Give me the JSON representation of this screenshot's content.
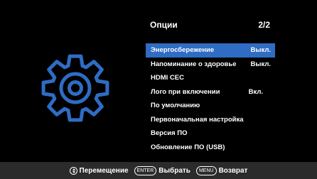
{
  "colors": {
    "background": "#000000",
    "highlight": "#2f6cc4",
    "gear": "#2f6cc4",
    "footer": "#2b2b2b",
    "text": "#ffffff"
  },
  "icon": "gear-icon",
  "menu": {
    "title": "Опции",
    "page": "2/2",
    "items": [
      {
        "label": "Энергосбережение",
        "value": "Выкл.",
        "selected": true
      },
      {
        "label": "Напоминание о здоровье",
        "value": "Выкл.",
        "selected": false
      },
      {
        "label": "HDMI CEC",
        "value": "",
        "selected": false
      },
      {
        "label": "Лого при включении",
        "value": "Вкл.",
        "selected": false
      },
      {
        "label": "По умолчанию",
        "value": "",
        "selected": false
      },
      {
        "label": "Первоначальная настройка",
        "value": "",
        "selected": false
      },
      {
        "label": "Версия ПО",
        "value": "",
        "selected": false
      },
      {
        "label": "Обновление ПО (USB)",
        "value": "",
        "selected": false
      }
    ]
  },
  "footer": {
    "move_label": "Перемещение",
    "enter_key": "ENTER",
    "select_label": "Выбрать",
    "menu_key": "MENU",
    "back_label": "Возврат"
  }
}
